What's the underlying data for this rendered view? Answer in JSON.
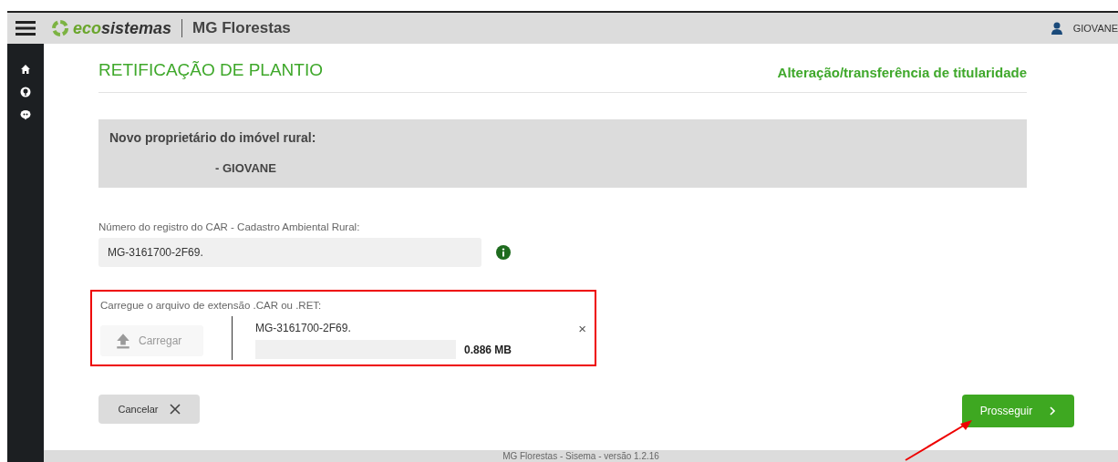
{
  "topbar": {
    "brand_eco": "eco",
    "brand_sistemas": "sistemas",
    "app_name": "MG Florestas",
    "user": "GIOVANE"
  },
  "page": {
    "title": "RETIFICAÇÃO DE PLANTIO",
    "subtitle": "Alteração/transferência de titularidade"
  },
  "owner_panel": {
    "label": "Novo proprietário do imóvel rural:",
    "value": "- GIOVANE"
  },
  "car_field": {
    "label": "Número do registro do CAR - Cadastro Ambiental Rural:",
    "value": "MG-3161700-2F69."
  },
  "upload": {
    "label": "Carregue o arquivo de extensão .CAR ou .RET:",
    "button": "Carregar",
    "button_disabled": true,
    "file_name": "MG-3161700-2F69.",
    "file_size": "0.886 MB",
    "level": 1,
    "remove": "×"
  },
  "buttons": {
    "cancel": "Cancelar",
    "proceed": "Prosseguir"
  },
  "footer": "MG Florestas - Sisema - versão 1.2.16"
}
